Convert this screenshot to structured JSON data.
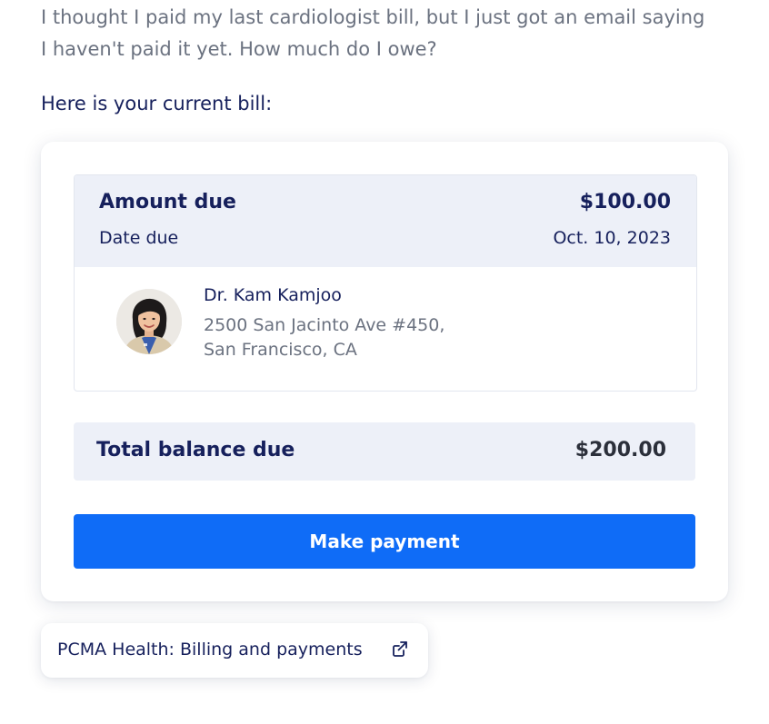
{
  "chat": {
    "user_message_line1": "I thought I paid my last cardiologist bill, but I just got an email saying",
    "user_message_line2": "I haven't paid it yet. How much do I owe?",
    "assistant_intro": "Here is your current bill:"
  },
  "bill": {
    "amount_label": "Amount due",
    "amount_value": "$100.00",
    "date_label": "Date due",
    "date_value": "Oct. 10, 2023",
    "provider": {
      "name": "Dr. Kam Kamjoo",
      "address_line1": "2500 San Jacinto Ave #450,",
      "address_line2": "San Francisco, CA",
      "avatar_icon": "doctor-photo"
    }
  },
  "total": {
    "label": "Total balance due",
    "value": "$200.00"
  },
  "actions": {
    "pay_label": "Make payment",
    "link_label": "PCMA Health: Billing and payments",
    "link_icon": "external-link-icon"
  },
  "colors": {
    "accent": "#0f6cf7",
    "header_bg": "#edf0f8",
    "text_primary": "#16205c",
    "text_secondary": "#6b7280"
  }
}
